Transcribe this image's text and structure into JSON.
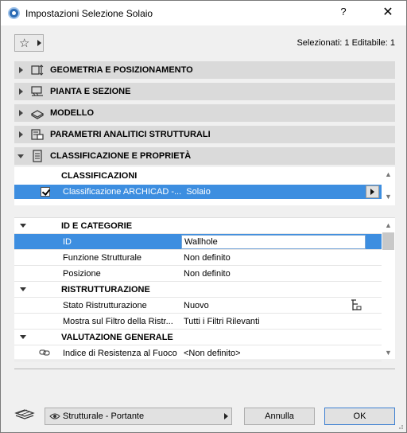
{
  "window": {
    "title": "Impostazioni Selezione Solaio",
    "help_label": "?",
    "close_label": "✕"
  },
  "status": {
    "text": "Selezionati: 1 Editabile: 1"
  },
  "panels": [
    {
      "label": "GEOMETRIA E POSIZIONAMENTO",
      "icon": "geometry-icon",
      "expanded": false
    },
    {
      "label": "PIANTA E SEZIONE",
      "icon": "floor-plan-icon",
      "expanded": false
    },
    {
      "label": "MODELLO",
      "icon": "model-icon",
      "expanded": false
    },
    {
      "label": "PARAMETRI ANALITICI STRUTTURALI",
      "icon": "structural-icon",
      "expanded": false
    },
    {
      "label": "CLASSIFICAZIONE E PROPRIETÀ",
      "icon": "document-icon",
      "expanded": true
    }
  ],
  "classifications": {
    "header": "CLASSIFICAZIONI",
    "row": {
      "name": "Classificazione ARCHICAD -...",
      "value": "Solaio",
      "checked": true
    }
  },
  "properties": {
    "groups": [
      {
        "name": "ID E CATEGORIE",
        "rows": [
          {
            "name": "ID",
            "value": "Wallhole"
          },
          {
            "name": "Funzione Strutturale",
            "value": "Non definito"
          },
          {
            "name": "Posizione",
            "value": "Non definito"
          }
        ]
      },
      {
        "name": "RISTRUTTURAZIONE",
        "rows": [
          {
            "name": "Stato Ristrutturazione",
            "value": "Nuovo"
          },
          {
            "name": "Mostra sul Filtro della Ristr...",
            "value": "Tutti i Filtri Rilevanti"
          }
        ]
      },
      {
        "name": "VALUTAZIONE GENERALE",
        "rows": [
          {
            "name": "Indice di Resistenza al Fuoco",
            "value": "<Non definito>"
          }
        ]
      }
    ]
  },
  "bottom": {
    "layer": "Strutturale - Portante",
    "cancel_label": "Annulla",
    "ok_label": "OK"
  },
  "colors": {
    "selection": "#3d8ee0",
    "panel_header": "#dadada"
  }
}
